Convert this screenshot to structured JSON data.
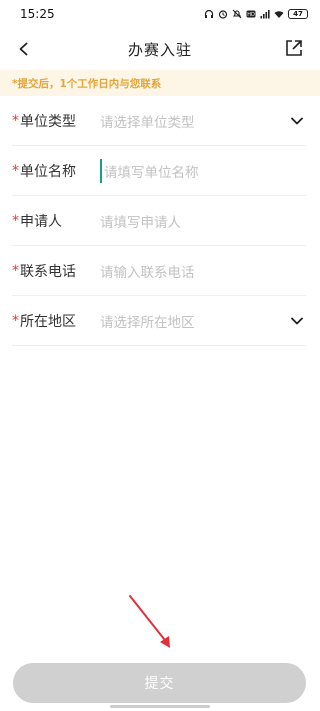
{
  "status_bar": {
    "time": "15:25",
    "battery": "47",
    "icons": [
      "headphones-icon",
      "alarm-icon",
      "mute-icon",
      "hd-icon",
      "signal-icon",
      "wifi-icon",
      "battery-icon"
    ]
  },
  "nav": {
    "title": "办赛入驻",
    "back_icon": "back-arrow-icon",
    "share_icon": "share-icon"
  },
  "notice": {
    "text": "*提交后，1个工作日内与您联系"
  },
  "form": {
    "required_mark": "*",
    "fields": [
      {
        "label": "单位类型",
        "placeholder": "请选择单位类型",
        "type": "select"
      },
      {
        "label": "单位名称",
        "placeholder": "请填写单位名称",
        "type": "text",
        "focused": true
      },
      {
        "label": "申请人",
        "placeholder": "请填写申请人",
        "type": "text"
      },
      {
        "label": "联系电话",
        "placeholder": "请输入联系电话",
        "type": "text"
      },
      {
        "label": "所在地区",
        "placeholder": "请选择所在地区",
        "type": "select"
      }
    ]
  },
  "submit": {
    "label": "提交",
    "enabled": false
  },
  "colors": {
    "required": "#e23c3c",
    "notice_bg": "#fdf6e6",
    "notice_text": "#e5a53a",
    "cursor": "#17a085",
    "button_disabled": "#d0d0d0",
    "annotation": "#e0303a"
  }
}
